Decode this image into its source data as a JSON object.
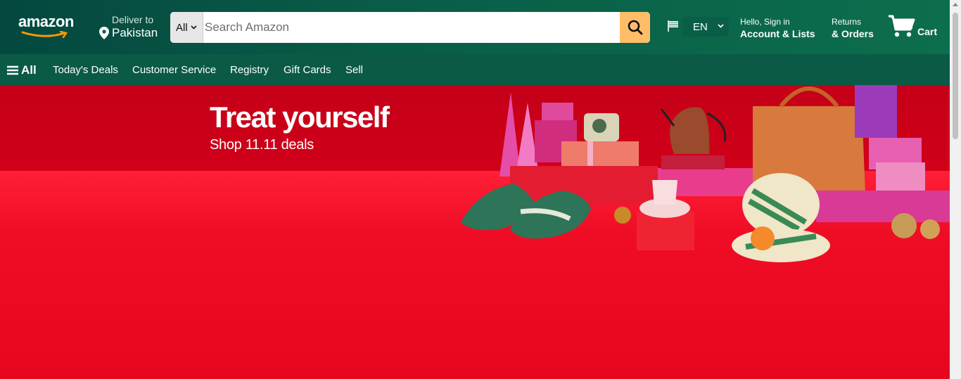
{
  "header": {
    "logo_text": "amazon",
    "deliver_label": "Deliver to",
    "deliver_location": "Pakistan",
    "search": {
      "category": "All",
      "placeholder": "Search Amazon",
      "value": ""
    },
    "language": "EN",
    "account_greeting": "Hello, Sign in",
    "account_label": "Account & Lists",
    "returns_label": "Returns",
    "orders_label": "& Orders",
    "cart_label": "Cart",
    "colors": {
      "header_bg": "#095c47",
      "nav_bg": "#0a5a46",
      "search_button": "#febd69"
    }
  },
  "nav": {
    "all_label": "All",
    "items": [
      "Today's Deals",
      "Customer Service",
      "Registry",
      "Gift Cards",
      "Sell"
    ]
  },
  "hero": {
    "title": "Treat yourself",
    "subtitle": "Shop 11.11 deals",
    "background_color": "#e8001d"
  },
  "icons": {
    "pin": "location-pin-icon",
    "search": "search-icon",
    "flag": "flag-icon",
    "cart": "cart-icon",
    "menu": "hamburger-menu-icon"
  }
}
